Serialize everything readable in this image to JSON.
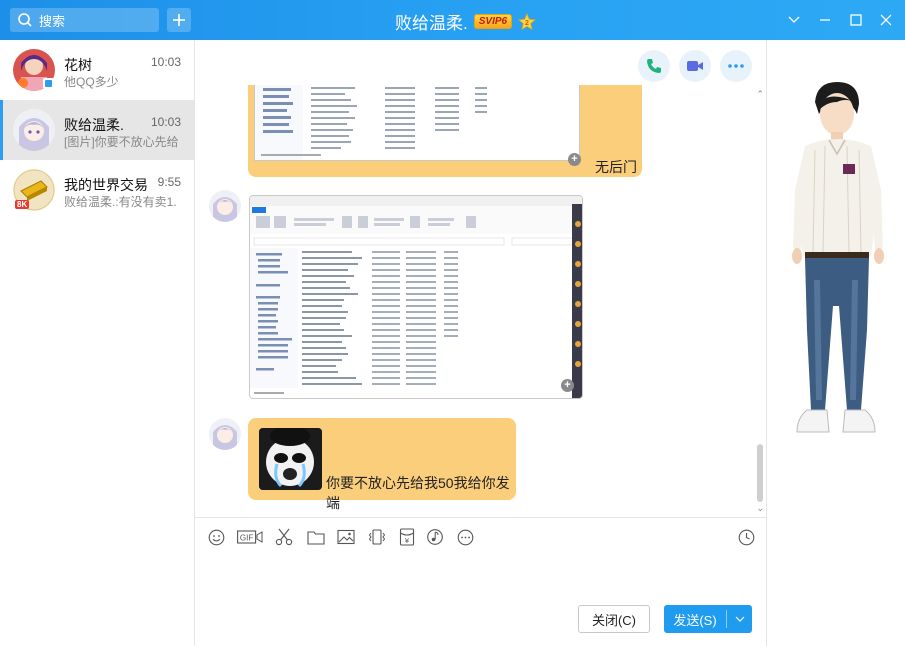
{
  "titlebar": {
    "search_placeholder": "搜索",
    "chat_title": "败给温柔.",
    "svip_badge": "SVIP6",
    "level_badge": "2"
  },
  "conversations": [
    {
      "name": "花树",
      "time": "10:03",
      "preview": "他QQ多少",
      "selected": false
    },
    {
      "name": "败给温柔.",
      "time": "10:03",
      "preview": "[图片]你要不放心先给",
      "selected": true
    },
    {
      "name": "我的世界交易",
      "time": "9:55",
      "preview": "败给温柔.:有没有卖1.",
      "selected": false,
      "badge": "8K"
    }
  ],
  "messages": [
    {
      "type": "image",
      "caption": "无后门"
    },
    {
      "type": "image",
      "caption": ""
    },
    {
      "type": "image",
      "caption": "你要不放心先给我50我给你发端"
    }
  ],
  "toolbar": {
    "icons": [
      "emoji-icon",
      "gif-icon",
      "screenshot-scissors-icon",
      "folder-icon",
      "image-icon",
      "shake-icon",
      "red-packet-icon",
      "music-icon",
      "more-icon",
      "history-icon"
    ],
    "gif_label": "GIF"
  },
  "buttons": {
    "close_label": "关闭(C)",
    "send_label": "发送(S)"
  },
  "colors": {
    "titlebar": "#27a0f2",
    "bubble": "#fbce7c",
    "send_button": "#1f9bef",
    "selected_row": "#e6e6e6"
  }
}
